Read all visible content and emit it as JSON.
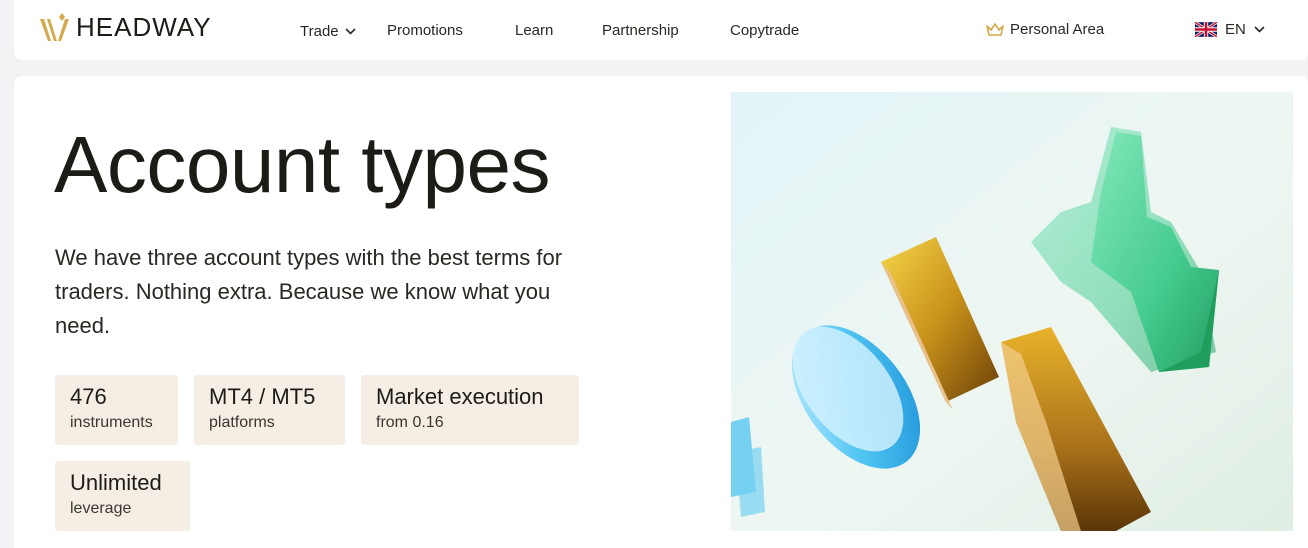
{
  "header": {
    "logo_text": "HEADWAY",
    "nav": {
      "trade": "Trade",
      "promotions": "Promotions",
      "learn": "Learn",
      "partnership": "Partnership",
      "copytrade": "Copytrade"
    },
    "personal_area": "Personal Area",
    "language": "EN"
  },
  "main": {
    "title": "Account types",
    "description": "We have three account types with the best terms for traders. Nothing extra. Because we know what you need.",
    "features": [
      {
        "value": "476",
        "label": "instruments"
      },
      {
        "value": "MT4 / MT5",
        "label": "platforms"
      },
      {
        "value": "Market execution",
        "label": "from 0.16"
      },
      {
        "value": "Unlimited",
        "label": "leverage"
      }
    ]
  },
  "colors": {
    "accent_gold": "#c9a24a",
    "chip_bg": "#f5eee5",
    "text_dark": "#1d1b16"
  }
}
